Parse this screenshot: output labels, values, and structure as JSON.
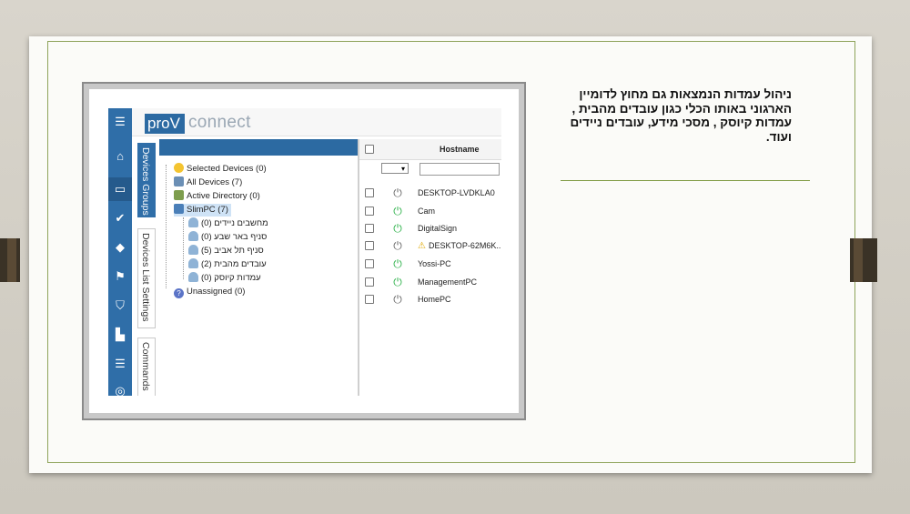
{
  "slide": {
    "description": "ניהול עמדות הנמצאות גם מחוץ לדומיין הארגוני באותו הכלי כגון עובדים מהבית , עמדות קיוסק , מסכי מידע, עובדים ניידים ועוד."
  },
  "app": {
    "brand": {
      "pro": "proV",
      "connect": "connect"
    },
    "nav_icons": [
      "menu-icon",
      "home-icon",
      "monitor-icon",
      "check-double-icon",
      "directions-icon",
      "flag-icon",
      "shield-icon",
      "building-icon",
      "list-check-icon",
      "database-icon"
    ],
    "vertical_tabs": [
      {
        "label": "Devices Groups",
        "active": true
      },
      {
        "label": "Devices List Settings",
        "active": false
      },
      {
        "label": "Commands",
        "active": false
      }
    ],
    "tree": [
      {
        "label": "Selected Devices (0)",
        "icon": "star-icon"
      },
      {
        "label": "All Devices (7)",
        "icon": "all-devices-icon"
      },
      {
        "label": "Active Directory (0)",
        "icon": "active-directory-icon"
      },
      {
        "label": "SlimPC (7)",
        "icon": "slimpc-icon",
        "selected": true
      },
      {
        "label": "מחשבים ניידים (0)",
        "icon": "group-icon"
      },
      {
        "label": "סניף באר שבע (0)",
        "icon": "group-icon"
      },
      {
        "label": "סניף תל אביב (5)",
        "icon": "group-icon"
      },
      {
        "label": "עובדים מהבית (2)",
        "icon": "group-icon"
      },
      {
        "label": "עמדות קיוסק (0)",
        "icon": "group-icon"
      },
      {
        "label": "Unassigned (0)",
        "icon": "unassigned-icon"
      }
    ],
    "list": {
      "header": "Hostname",
      "filter_select": "",
      "filter_input": "",
      "devices": [
        {
          "name": "DESKTOP-LVDKLA0",
          "power": "off",
          "warning": false
        },
        {
          "name": "Cam",
          "power": "on",
          "warning": false
        },
        {
          "name": "DigitalSign",
          "power": "on",
          "warning": false
        },
        {
          "name": "DESKTOP-62M6K...",
          "power": "off",
          "warning": true
        },
        {
          "name": "Yossi-PC",
          "power": "on",
          "warning": false
        },
        {
          "name": "ManagementPC",
          "power": "on",
          "warning": false
        },
        {
          "name": "HomePC",
          "power": "off",
          "warning": false
        }
      ]
    }
  }
}
